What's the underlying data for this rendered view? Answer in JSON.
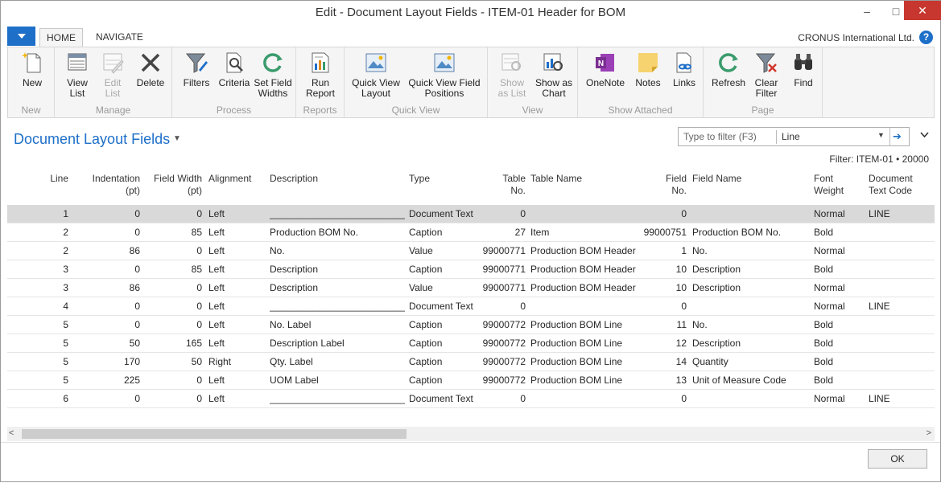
{
  "window": {
    "title": "Edit - Document Layout Fields - ITEM-01 Header for BOM",
    "min_glyph": "–",
    "max_glyph": "□",
    "close_glyph": "✕"
  },
  "ribbon_tabs": [
    {
      "label": "HOME"
    },
    {
      "label": "NAVIGATE"
    }
  ],
  "company": "CRONUS International Ltd.",
  "help_glyph": "?",
  "ribbon": {
    "groups": [
      {
        "label": "New",
        "buttons": [
          {
            "label": "New",
            "icon": "new-document-icon"
          }
        ]
      },
      {
        "label": "Manage",
        "buttons": [
          {
            "label": "View\nList",
            "icon": "view-list-icon"
          },
          {
            "label": "Edit\nList",
            "icon": "edit-list-icon",
            "disabled": true
          },
          {
            "label": "Delete",
            "icon": "delete-icon"
          }
        ]
      },
      {
        "label": "Process",
        "buttons": [
          {
            "label": "Filters",
            "icon": "filter-icon"
          },
          {
            "label": "Criteria",
            "icon": "criteria-icon"
          },
          {
            "label": "Set Field\nWidths",
            "icon": "set-field-widths-icon"
          }
        ]
      },
      {
        "label": "Reports",
        "buttons": [
          {
            "label": "Run\nReport",
            "icon": "run-report-icon"
          }
        ]
      },
      {
        "label": "Quick View",
        "buttons": [
          {
            "label": "Quick View\nLayout",
            "icon": "quick-view-layout-icon"
          },
          {
            "label": "Quick View Field\nPositions",
            "icon": "quick-view-positions-icon"
          }
        ]
      },
      {
        "label": "View",
        "buttons": [
          {
            "label": "Show\nas List",
            "icon": "show-as-list-icon",
            "disabled": true
          },
          {
            "label": "Show as\nChart",
            "icon": "show-as-chart-icon"
          }
        ]
      },
      {
        "label": "Show Attached",
        "buttons": [
          {
            "label": "OneNote",
            "icon": "onenote-icon"
          },
          {
            "label": "Notes",
            "icon": "notes-icon"
          },
          {
            "label": "Links",
            "icon": "links-icon"
          }
        ]
      },
      {
        "label": "Page",
        "buttons": [
          {
            "label": "Refresh",
            "icon": "refresh-icon"
          },
          {
            "label": "Clear\nFilter",
            "icon": "clear-filter-icon"
          },
          {
            "label": "Find",
            "icon": "find-icon"
          }
        ]
      }
    ]
  },
  "page": {
    "title": "Document Layout Fields",
    "filter_placeholder": "Type to filter (F3)",
    "filter_field": "Line",
    "filter_status": "Filter: ITEM-01 • 20000"
  },
  "table": {
    "columns": [
      {
        "key": "line",
        "label": "Line",
        "align": "right"
      },
      {
        "key": "indent",
        "label": "Indentation\n(pt)",
        "align": "right"
      },
      {
        "key": "width",
        "label": "Field Width\n(pt)",
        "align": "right"
      },
      {
        "key": "align",
        "label": "Alignment",
        "align": "left"
      },
      {
        "key": "desc",
        "label": "Description",
        "align": "left"
      },
      {
        "key": "type",
        "label": "Type",
        "align": "left"
      },
      {
        "key": "tblno",
        "label": "Table\nNo.",
        "align": "right"
      },
      {
        "key": "tblname",
        "label": "Table Name",
        "align": "left"
      },
      {
        "key": "fldno",
        "label": "Field\nNo.",
        "align": "right"
      },
      {
        "key": "fldname",
        "label": "Field Name",
        "align": "left"
      },
      {
        "key": "weight",
        "label": "Font\nWeight",
        "align": "left"
      },
      {
        "key": "code",
        "label": "Document\nText Code",
        "align": "left"
      }
    ],
    "rows": [
      {
        "line": "1",
        "indent": "0",
        "width": "0",
        "align": "Left",
        "desc": "_______________________________...",
        "type": "Document Text",
        "tblno": "0",
        "tblname": "",
        "fldno": "0",
        "fldname": "",
        "weight": "Normal",
        "code": "LINE"
      },
      {
        "line": "2",
        "indent": "0",
        "width": "85",
        "align": "Left",
        "desc": "Production BOM No.",
        "type": "Caption",
        "tblno": "27",
        "tblname": "Item",
        "fldno": "99000751",
        "fldname": "Production BOM No.",
        "weight": "Bold",
        "code": ""
      },
      {
        "line": "2",
        "indent": "86",
        "width": "0",
        "align": "Left",
        "desc": "No.",
        "type": "Value",
        "tblno": "99000771",
        "tblname": "Production BOM Header",
        "fldno": "1",
        "fldname": "No.",
        "weight": "Normal",
        "code": ""
      },
      {
        "line": "3",
        "indent": "0",
        "width": "85",
        "align": "Left",
        "desc": "Description",
        "type": "Caption",
        "tblno": "99000771",
        "tblname": "Production BOM Header",
        "fldno": "10",
        "fldname": "Description",
        "weight": "Bold",
        "code": ""
      },
      {
        "line": "3",
        "indent": "86",
        "width": "0",
        "align": "Left",
        "desc": "Description",
        "type": "Value",
        "tblno": "99000771",
        "tblname": "Production BOM Header",
        "fldno": "10",
        "fldname": "Description",
        "weight": "Normal",
        "code": ""
      },
      {
        "line": "4",
        "indent": "0",
        "width": "0",
        "align": "Left",
        "desc": "_______________________________...",
        "type": "Document Text",
        "tblno": "0",
        "tblname": "",
        "fldno": "0",
        "fldname": "",
        "weight": "Normal",
        "code": "LINE"
      },
      {
        "line": "5",
        "indent": "0",
        "width": "0",
        "align": "Left",
        "desc": "No. Label",
        "type": "Caption",
        "tblno": "99000772",
        "tblname": "Production BOM Line",
        "fldno": "11",
        "fldname": "No.",
        "weight": "Bold",
        "code": ""
      },
      {
        "line": "5",
        "indent": "50",
        "width": "165",
        "align": "Left",
        "desc": "Description Label",
        "type": "Caption",
        "tblno": "99000772",
        "tblname": "Production BOM Line",
        "fldno": "12",
        "fldname": "Description",
        "weight": "Bold",
        "code": ""
      },
      {
        "line": "5",
        "indent": "170",
        "width": "50",
        "align": "Right",
        "desc": "Qty. Label",
        "type": "Caption",
        "tblno": "99000772",
        "tblname": "Production BOM Line",
        "fldno": "14",
        "fldname": "Quantity",
        "weight": "Bold",
        "code": ""
      },
      {
        "line": "5",
        "indent": "225",
        "width": "0",
        "align": "Left",
        "desc": "UOM Label",
        "type": "Caption",
        "tblno": "99000772",
        "tblname": "Production BOM Line",
        "fldno": "13",
        "fldname": "Unit of Measure Code",
        "weight": "Bold",
        "code": ""
      },
      {
        "line": "6",
        "indent": "0",
        "width": "0",
        "align": "Left",
        "desc": "_______________________________...",
        "type": "Document Text",
        "tblno": "0",
        "tblname": "",
        "fldno": "0",
        "fldname": "",
        "weight": "Normal",
        "code": "LINE"
      }
    ],
    "selected_row": 0
  },
  "scrollbar": {
    "left_glyph": "<",
    "right_glyph": ">"
  },
  "footer": {
    "ok_label": "OK"
  },
  "colors": {
    "accent": "#1e6fc8",
    "close": "#c7372f",
    "selected_row": "#d9d9d9"
  }
}
